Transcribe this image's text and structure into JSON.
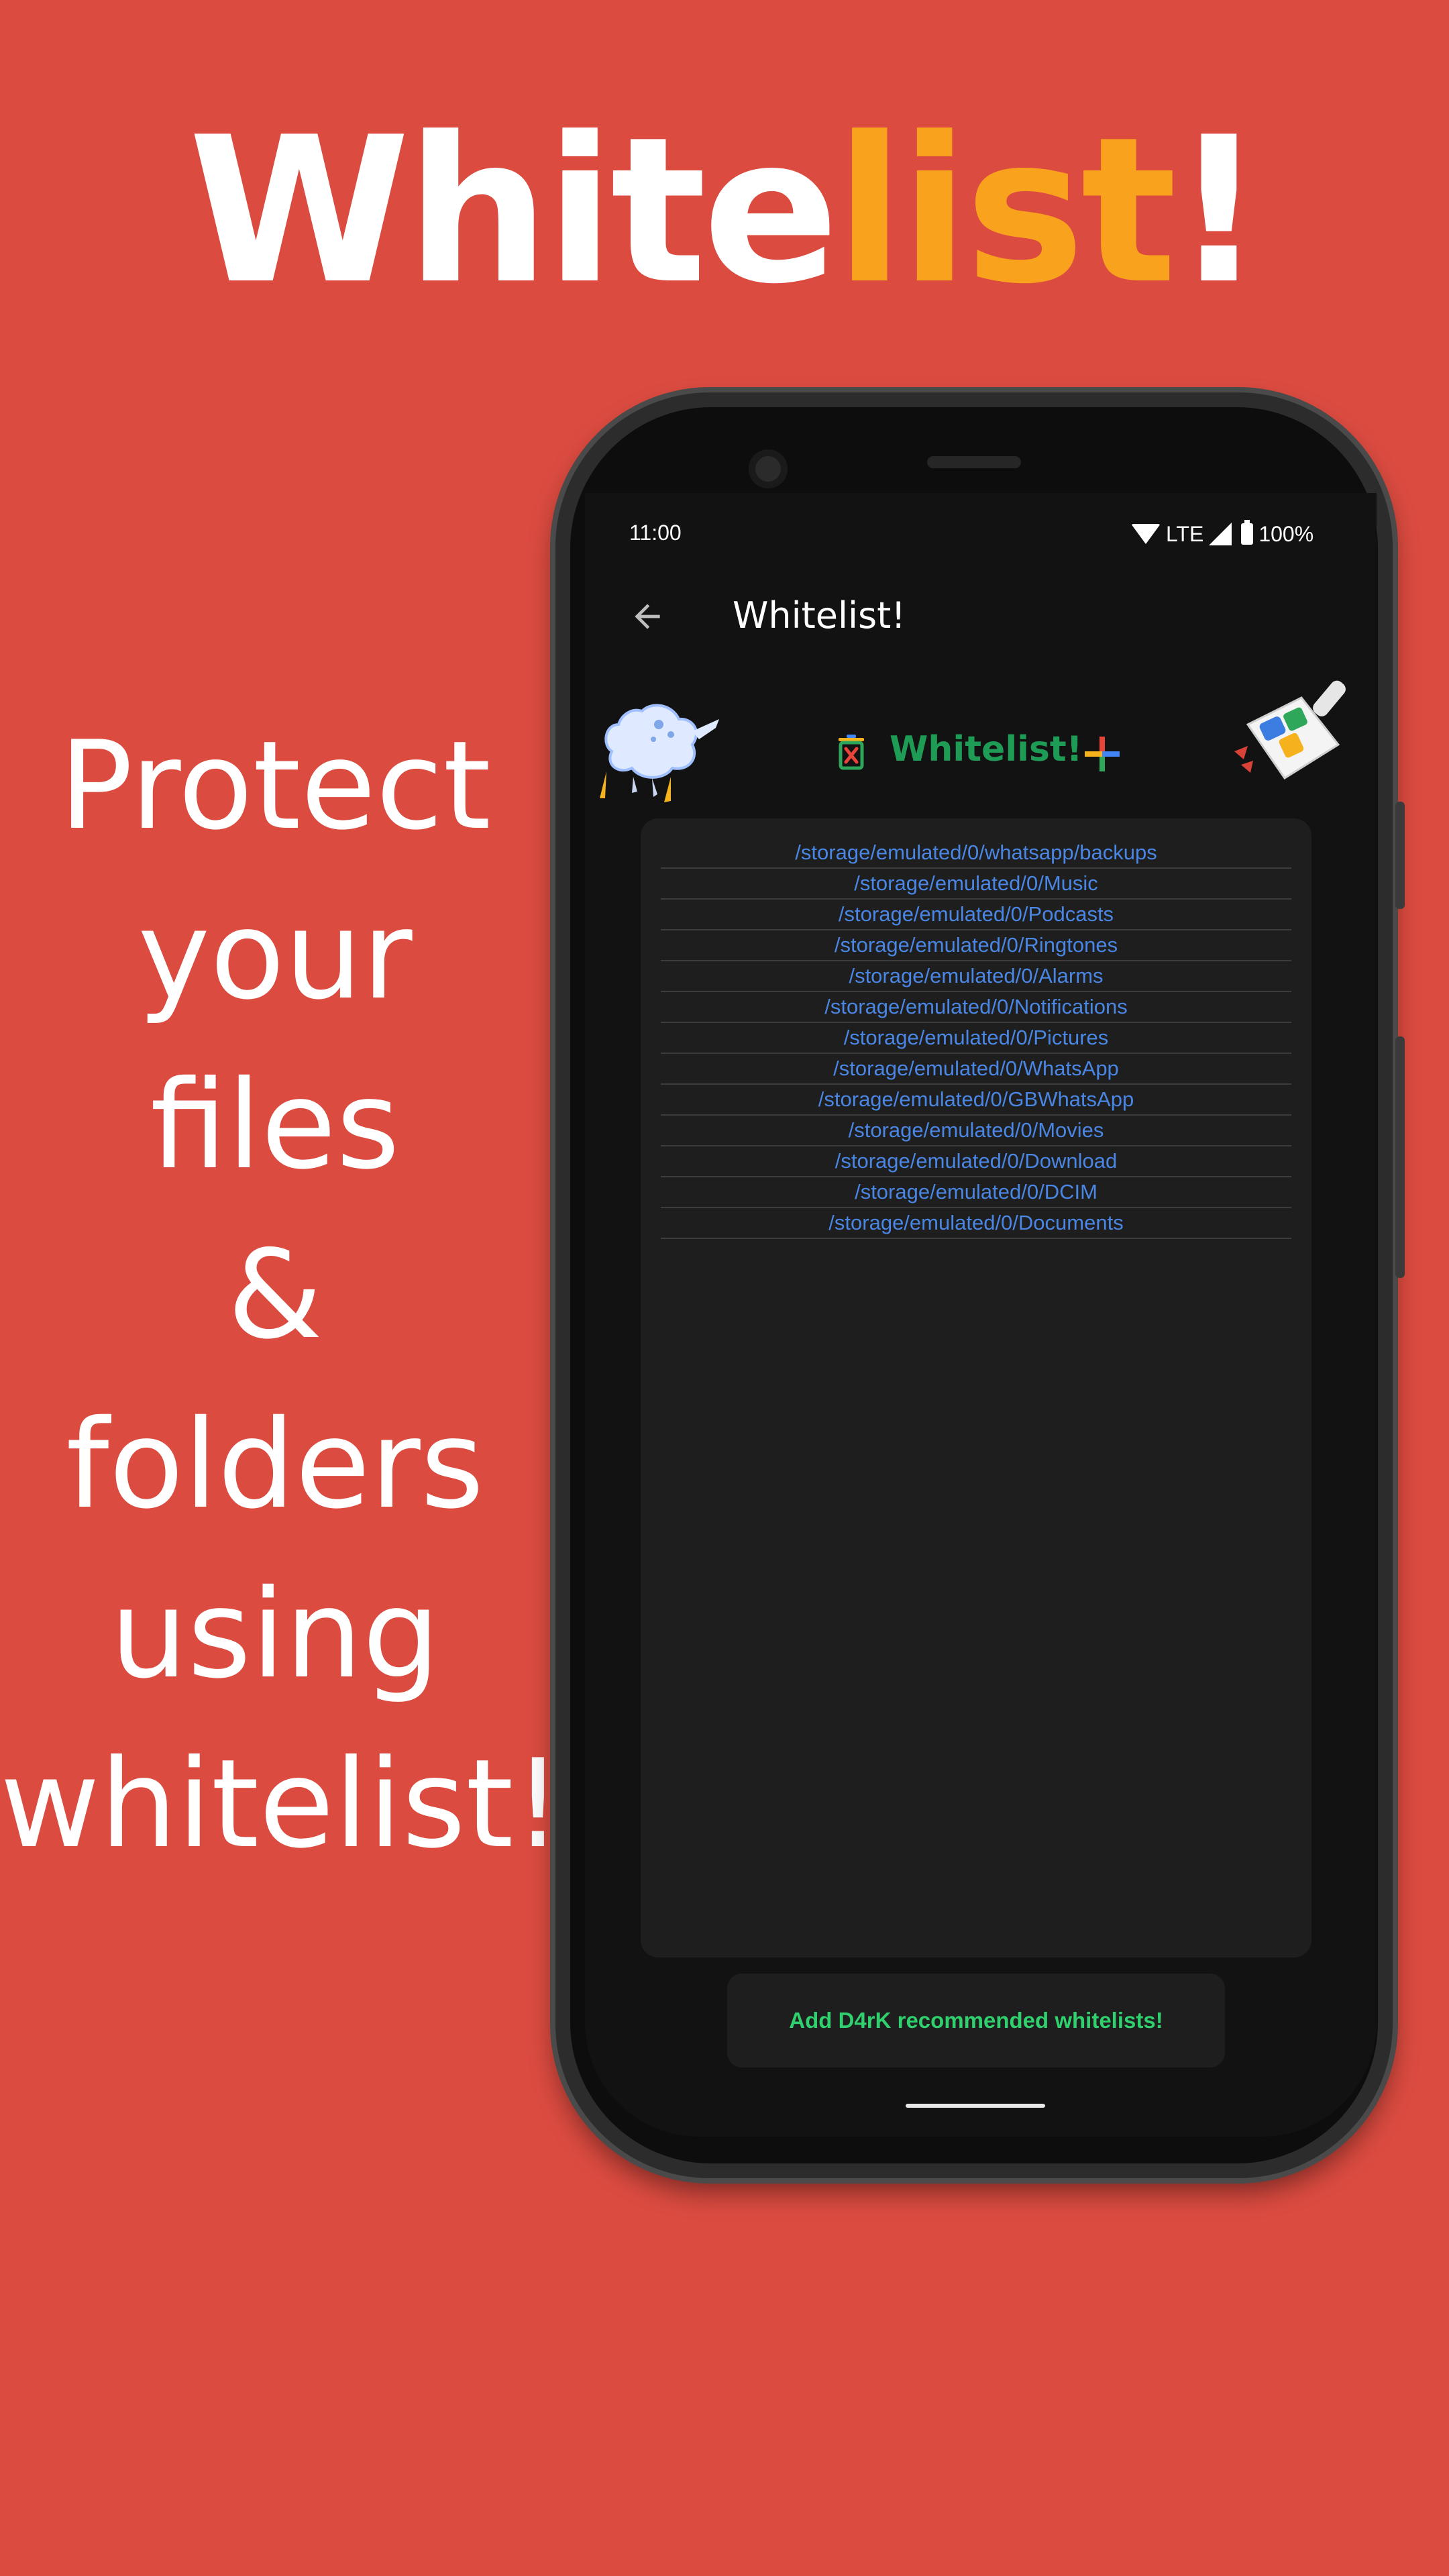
{
  "promo": {
    "headline_main": "White",
    "headline_accent": "list",
    "headline_end": "!",
    "tagline": [
      "Protect",
      "your",
      "files",
      "&",
      "folders",
      "using",
      "whitelist!"
    ],
    "colors": {
      "background": "#dc4b40",
      "accent": "#f9a21d"
    }
  },
  "status_bar": {
    "time": "11:00",
    "network": "LTE",
    "battery": "100%"
  },
  "app_bar": {
    "back_icon": "arrow-back-icon",
    "title": "Whitelist!"
  },
  "whitelist": {
    "title": "Whitelist!",
    "title_color": "#1e9b55",
    "clear_icon": "trash-icon",
    "add_icon": "plus-icon",
    "paths": [
      "/storage/emulated/0/whatsapp/backups",
      "/storage/emulated/0/Music",
      "/storage/emulated/0/Podcasts",
      "/storage/emulated/0/Ringtones",
      "/storage/emulated/0/Alarms",
      "/storage/emulated/0/Notifications",
      "/storage/emulated/0/Pictures",
      "/storage/emulated/0/WhatsApp",
      "/storage/emulated/0/GBWhatsApp",
      "/storage/emulated/0/Movies",
      "/storage/emulated/0/Download",
      "/storage/emulated/0/DCIM",
      "/storage/emulated/0/Documents"
    ],
    "path_color": "#4a86e4"
  },
  "recommend_button": {
    "label": "Add D4rK recommended whitelists!",
    "color": "#2fd06d"
  }
}
